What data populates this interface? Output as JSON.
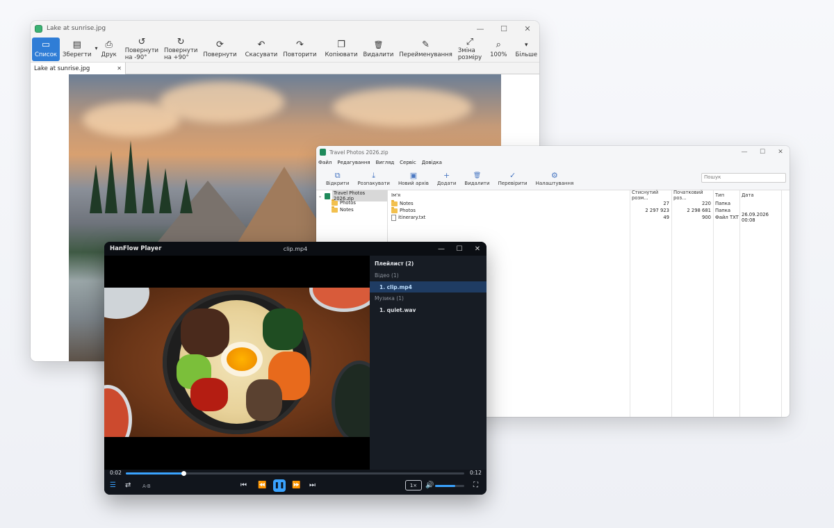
{
  "viewer": {
    "title": "Lake at sunrise.jpg",
    "toolbar": [
      {
        "label": "Список",
        "icon": "folder-image-icon",
        "glyph": "▭"
      },
      {
        "label": "Зберегти",
        "icon": "save-icon",
        "glyph": "▤"
      },
      {
        "label": "Друк",
        "icon": "printer-icon",
        "glyph": "⎙"
      },
      {
        "label": "Повернути на -90°",
        "icon": "rotate-left-icon",
        "glyph": "↺"
      },
      {
        "label": "Повернути на +90°",
        "icon": "rotate-right-icon",
        "glyph": "↻"
      },
      {
        "label": "Повернути",
        "icon": "rotate-icon",
        "glyph": "⟳"
      },
      {
        "label": "Скасувати",
        "icon": "undo-icon",
        "glyph": "↶"
      },
      {
        "label": "Повторити",
        "icon": "redo-icon",
        "glyph": "↷"
      },
      {
        "label": "Копіювати",
        "icon": "copy-icon",
        "glyph": "❐"
      },
      {
        "label": "Видалити",
        "icon": "trash-icon",
        "glyph": "🗑"
      },
      {
        "label": "Перейменування",
        "icon": "rename-icon",
        "glyph": "✎"
      },
      {
        "label": "Зміна розміру",
        "icon": "resize-icon",
        "glyph": "⤢"
      },
      {
        "label": "100%",
        "icon": "zoom-icon",
        "glyph": "⌕"
      },
      {
        "label": "Більше",
        "icon": "chevron-down-icon",
        "glyph": "▾"
      }
    ],
    "tab": {
      "label": "Lake at sunrise.jpg",
      "close": "✕"
    }
  },
  "archive": {
    "title": "Travel Photos 2026.zip",
    "menu": [
      "Файл",
      "Редагування",
      "Вигляд",
      "Сервіс",
      "Довідка"
    ],
    "toolbar": [
      {
        "label": "Відкрити",
        "icon": "open-icon",
        "glyph": "⧉"
      },
      {
        "label": "Розпакувати",
        "icon": "extract-icon",
        "glyph": "⤓"
      },
      {
        "label": "Новий архів",
        "icon": "new-archive-icon",
        "glyph": "▣"
      },
      {
        "label": "Додати",
        "icon": "plus-icon",
        "glyph": "+"
      },
      {
        "label": "Видалити",
        "icon": "trash-icon",
        "glyph": "🗑"
      },
      {
        "label": "Перевірити",
        "icon": "check-icon",
        "glyph": "✓"
      },
      {
        "label": "Налаштування",
        "icon": "gear-icon",
        "glyph": "⚙"
      }
    ],
    "search_placeholder": "Пошук",
    "tree": {
      "root": "Travel Photos 2026.zip",
      "children": [
        "Photos",
        "Notes"
      ]
    },
    "columns": {
      "name": "Ім'я",
      "compressed": "Стиснутий розм...",
      "original": "Початковий роз...",
      "type": "Тип",
      "date": "Дата"
    },
    "rows": [
      {
        "name": "Notes",
        "kind": "folder",
        "compressed": "27",
        "original": "220",
        "type": "Папка",
        "date": ""
      },
      {
        "name": "Photos",
        "kind": "folder",
        "compressed": "2 297 923",
        "original": "2 298 681",
        "type": "Папка",
        "date": ""
      },
      {
        "name": "itinerary.txt",
        "kind": "file",
        "compressed": "49",
        "original": "900",
        "type": "Файл TXT",
        "date": "26.09.2026 00:08"
      }
    ]
  },
  "player": {
    "app_name": "HanFlow Player",
    "file_title": "clip.mp4",
    "playlist": {
      "header": "Плейлист (2)",
      "groups": [
        {
          "label": "Відео (1)",
          "items": [
            "1. clip.mp4"
          ]
        },
        {
          "label": "Музика (1)",
          "items": [
            "1. quiet.wav"
          ]
        }
      ]
    },
    "time_current": "0:02",
    "time_total": "0:12",
    "progress": 0.17,
    "ab_label": "A-B",
    "speed": "1×",
    "volume": 0.68
  }
}
